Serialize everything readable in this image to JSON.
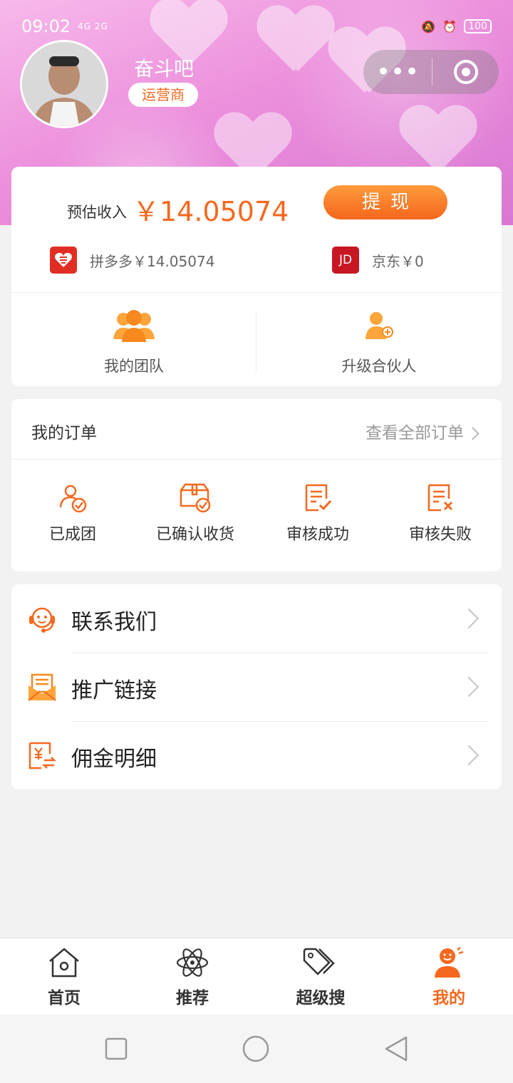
{
  "status": {
    "time": "09:02",
    "signal": "4G 2G",
    "battery": "100"
  },
  "profile": {
    "nickname": "奋斗吧",
    "role": "运营商"
  },
  "earnings": {
    "label": "预估收入",
    "amount": "￥14.05074",
    "withdraw_label": "提现",
    "platforms": [
      {
        "name": "拼多多￥14.05074",
        "icon": "pinduoduo-logo"
      },
      {
        "name": "京东￥0",
        "icon": "jd-logo",
        "logo_text": "JD"
      }
    ]
  },
  "quick_actions": [
    {
      "label": "我的团队",
      "icon": "team-icon"
    },
    {
      "label": "升级合伙人",
      "icon": "partner-icon"
    }
  ],
  "orders": {
    "title": "我的订单",
    "view_all": "查看全部订单",
    "statuses": [
      {
        "label": "已成团",
        "icon": "group-done-icon"
      },
      {
        "label": "已确认收货",
        "icon": "package-confirmed-icon"
      },
      {
        "label": "审核成功",
        "icon": "review-success-icon"
      },
      {
        "label": "审核失败",
        "icon": "review-failed-icon"
      }
    ]
  },
  "menu": [
    {
      "label": "联系我们",
      "icon": "customer-service-icon"
    },
    {
      "label": "推广链接",
      "icon": "promo-link-icon"
    },
    {
      "label": "佣金明细",
      "icon": "commission-icon"
    }
  ],
  "tabs": [
    {
      "label": "首页",
      "icon": "home-icon"
    },
    {
      "label": "推荐",
      "icon": "atom-icon"
    },
    {
      "label": "超级搜",
      "icon": "tags-icon"
    },
    {
      "label": "我的",
      "icon": "profile-icon",
      "active": true
    }
  ],
  "colors": {
    "accent": "#f5691f",
    "pdd": "#e02e24",
    "jd": "#c81623"
  }
}
